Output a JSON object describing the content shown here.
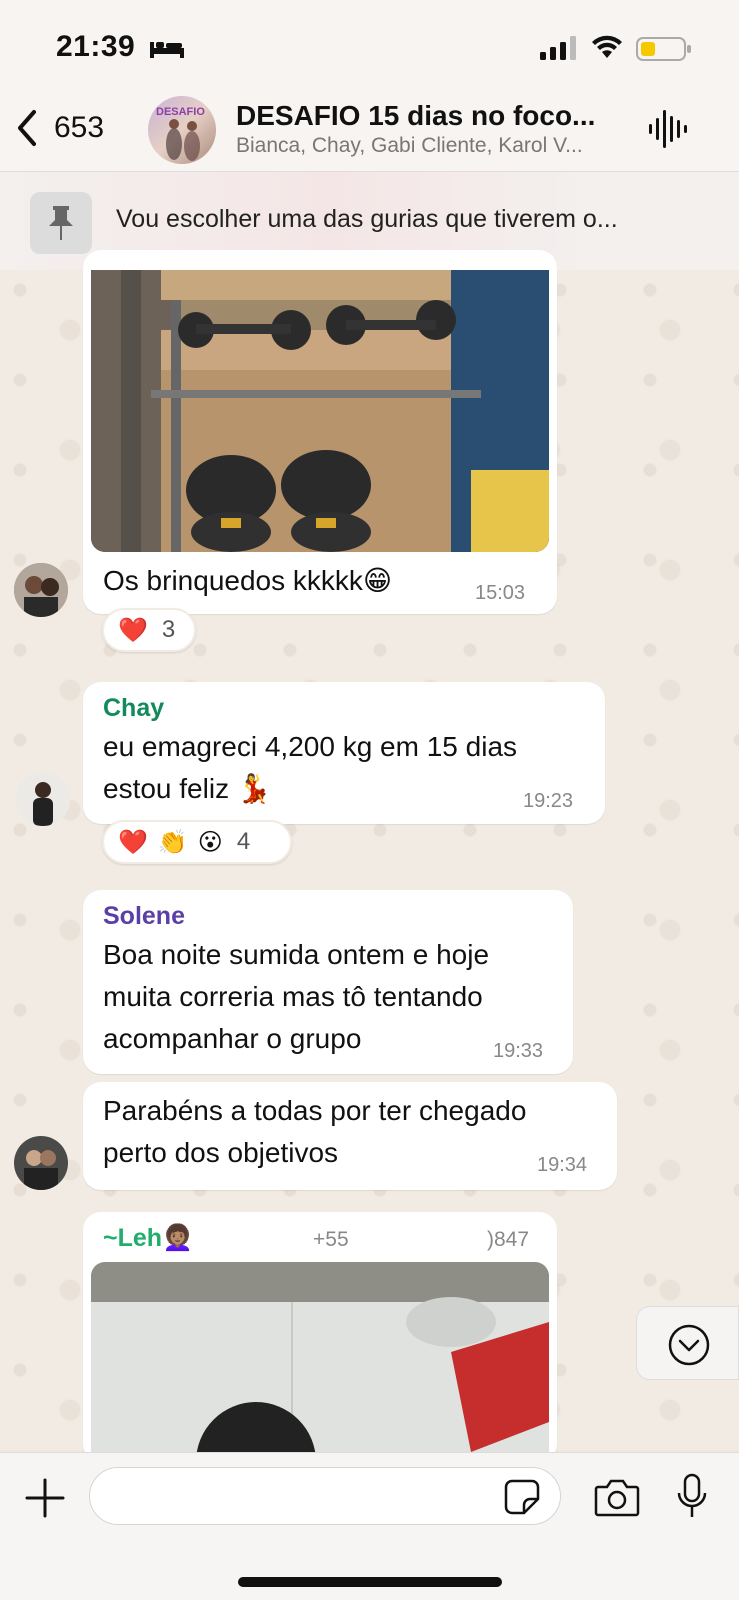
{
  "status_bar": {
    "time": "21:39"
  },
  "header": {
    "back_count": "653",
    "group_avatar_text": "DESAFIO",
    "title": "DESAFIO 15 dias no foco...",
    "subtitle": "Bianca, Chay, Gabi Cliente, Karol V..."
  },
  "pinned": {
    "text": "Vou escolher uma das gurias que tiverem o..."
  },
  "messages": [
    {
      "text": "Os brinquedos kkkkk😁",
      "time": "15:03",
      "reactions": [
        "❤️"
      ],
      "reaction_count": "3"
    },
    {
      "sender": "Chay",
      "sender_color": "#138a5c",
      "text_line1": "eu emagreci 4,200 kg em 15 dias",
      "text_line2": "estou feliz 💃",
      "time": "19:23",
      "reactions": [
        "❤️",
        "👏",
        "😮"
      ],
      "reaction_count": "4"
    },
    {
      "sender": "Solene",
      "sender_color": "#5b3fa6",
      "text_line1": "Boa noite sumida ontem e hoje",
      "text_line2": "muita correria mas tô tentando",
      "text_line3": "acompanhar o grupo",
      "time": "19:33"
    },
    {
      "text_line1": "Parabéns a todas por ter chegado",
      "text_line2": "perto dos objetivos",
      "time": "19:34"
    },
    {
      "sender": "~Leh👩🏽‍🦱",
      "sender_color": "#1fae6b",
      "phone_prefix": "+55",
      "phone_suffix": ")847"
    }
  ],
  "colors": {
    "background": "#efe7de",
    "bubble": "#ffffff",
    "accent": "#25d366"
  }
}
